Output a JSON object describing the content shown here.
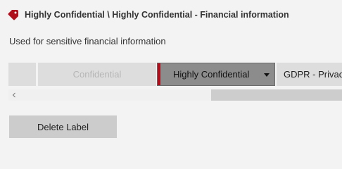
{
  "header": {
    "title": "Highly Confidential \\ Highly Confidential - Financial information",
    "icon": "tag-icon",
    "icon_color": "#b10e1c"
  },
  "description": "Used for sensitive financial information",
  "label_strip": {
    "items": [
      {
        "label": "Confidential",
        "state": "disabled"
      },
      {
        "label": "Highly Confidential",
        "state": "selected",
        "color": "#b10e1c",
        "has_dropdown": true
      },
      {
        "label": "GDPR - Privacy",
        "state": "normal"
      }
    ]
  },
  "scrollbar": {
    "left_arrow_icon": "chevron-left-icon"
  },
  "actions": {
    "delete_label": "Delete Label"
  }
}
